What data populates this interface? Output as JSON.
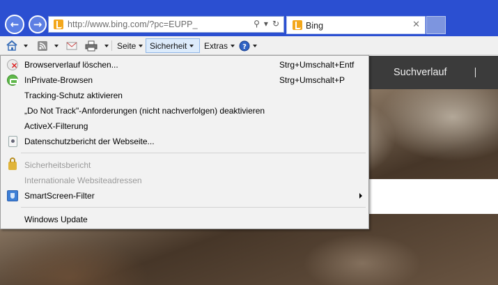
{
  "browser": {
    "address_url": "http://www.bing.com/?pc=EUPP_",
    "tab_title": "Bing"
  },
  "command_bar": {
    "page_label": "Seite",
    "safety_label": "Sicherheit",
    "tools_label": "Extras"
  },
  "page": {
    "search_history": "Suchverlauf",
    "separator": "|"
  },
  "menu": {
    "items": [
      {
        "label": "Browserverlauf löschen...",
        "shortcut": "Strg+Umschalt+Entf",
        "enabled": true,
        "icon": "delete-history-icon"
      },
      {
        "label": "InPrivate-Browsen",
        "shortcut": "Strg+Umschalt+P",
        "enabled": true,
        "icon": "inprivate-icon"
      },
      {
        "label": "Tracking-Schutz aktivieren",
        "shortcut": "",
        "enabled": true,
        "icon": ""
      },
      {
        "label": "„Do Not Track\"-Anforderungen (nicht nachverfolgen) deaktivieren",
        "shortcut": "",
        "enabled": true,
        "icon": ""
      },
      {
        "label": "ActiveX-Filterung",
        "shortcut": "",
        "enabled": true,
        "icon": ""
      },
      {
        "label": "Datenschutzbericht der Webseite...",
        "shortcut": "",
        "enabled": true,
        "icon": "privacy-report-icon"
      },
      {
        "label": "Sicherheitsbericht",
        "shortcut": "",
        "enabled": false,
        "icon": "lock-icon"
      },
      {
        "label": "Internationale Websiteadressen",
        "shortcut": "",
        "enabled": false,
        "icon": ""
      },
      {
        "label": "SmartScreen-Filter",
        "shortcut": "",
        "enabled": true,
        "icon": "smartscreen-icon",
        "submenu": true
      },
      {
        "label": "Windows Update",
        "shortcut": "",
        "enabled": true,
        "icon": ""
      }
    ]
  },
  "colors": {
    "title_bar": "#2b4fd1",
    "menu_background": "#f2f2f2",
    "disabled_text": "#9a9a9a"
  }
}
